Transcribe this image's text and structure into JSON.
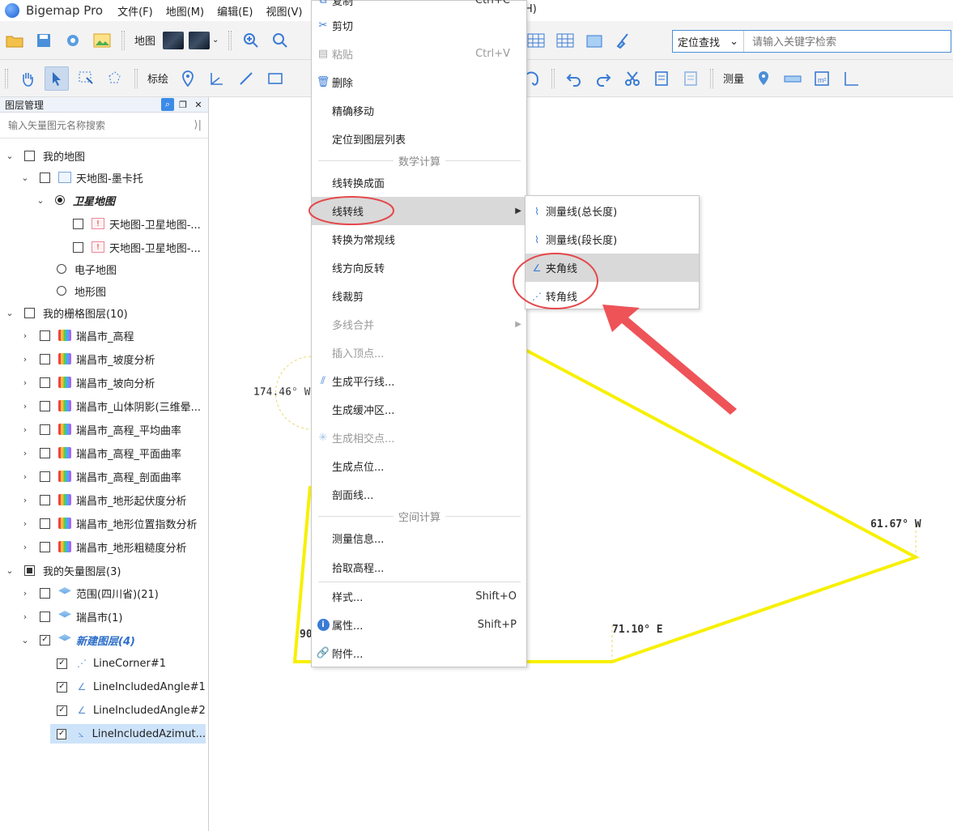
{
  "app": {
    "title": "Bigemap Pro",
    "menu_help_tail": "H)"
  },
  "menu": [
    "文件(F)",
    "地图(M)",
    "编辑(E)",
    "视图(V)"
  ],
  "toolbar1": {
    "map_label": "地图",
    "search_mode": "定位查找",
    "search_placeholder": "请输入关键字检索"
  },
  "toolbar2": {
    "mark_label": "标绘",
    "measure_label": "测量"
  },
  "layer_panel": {
    "title": "图层管理",
    "search_placeholder": "输入矢量图元名称搜索",
    "rows": [
      {
        "label": "我的地图"
      },
      {
        "label": "天地图-墨卡托"
      },
      {
        "label": "卫星地图"
      },
      {
        "label": "天地图-卫星地图-..."
      },
      {
        "label": "天地图-卫星地图-..."
      },
      {
        "label": "电子地图"
      },
      {
        "label": "地形图"
      },
      {
        "label": "我的栅格图层(10)"
      },
      {
        "label": "瑞昌市_高程"
      },
      {
        "label": "瑞昌市_坡度分析"
      },
      {
        "label": "瑞昌市_坡向分析"
      },
      {
        "label": "瑞昌市_山体阴影(三维晕..."
      },
      {
        "label": "瑞昌市_高程_平均曲率"
      },
      {
        "label": "瑞昌市_高程_平面曲率"
      },
      {
        "label": "瑞昌市_高程_剖面曲率"
      },
      {
        "label": "瑞昌市_地形起伏度分析"
      },
      {
        "label": "瑞昌市_地形位置指数分析"
      },
      {
        "label": "瑞昌市_地形粗糙度分析"
      },
      {
        "label": "我的矢量图层(3)"
      },
      {
        "label": "范围(四川省)(21)"
      },
      {
        "label": "瑞昌市(1)"
      },
      {
        "label": "新建图层(4)"
      },
      {
        "label": "LineCorner#1"
      },
      {
        "label": "LineIncludedAngle#1"
      },
      {
        "label": "LineIncludedAngle#2"
      },
      {
        "label": "LineIncludedAzimut..."
      }
    ]
  },
  "context_menu": {
    "items": [
      {
        "label": "复制",
        "shortcut": "Ctrl+C"
      },
      {
        "label": "剪切",
        "shortcut": ""
      },
      {
        "label": "粘贴",
        "shortcut": "Ctrl+V"
      },
      {
        "label": "删除",
        "shortcut": ""
      },
      {
        "label": "精确移动",
        "shortcut": ""
      },
      {
        "label": "定位到图层列表",
        "shortcut": ""
      },
      {
        "label": "数学计算"
      },
      {
        "label": "线转换成面",
        "shortcut": ""
      },
      {
        "label": "线转线",
        "shortcut": ""
      },
      {
        "label": "转换为常规线",
        "shortcut": ""
      },
      {
        "label": "线方向反转",
        "shortcut": ""
      },
      {
        "label": "线裁剪",
        "shortcut": ""
      },
      {
        "label": "多线合并",
        "shortcut": ""
      },
      {
        "label": "插入顶点...",
        "shortcut": ""
      },
      {
        "label": "生成平行线...",
        "shortcut": ""
      },
      {
        "label": "生成缓冲区...",
        "shortcut": ""
      },
      {
        "label": "生成相交点...",
        "shortcut": ""
      },
      {
        "label": "生成点位...",
        "shortcut": ""
      },
      {
        "label": "剖面线...",
        "shortcut": ""
      },
      {
        "label": "空间计算"
      },
      {
        "label": "测量信息...",
        "shortcut": ""
      },
      {
        "label": "拾取高程...",
        "shortcut": ""
      },
      {
        "label": "样式...",
        "shortcut": "Shift+O"
      },
      {
        "label": "属性...",
        "shortcut": "Shift+P"
      },
      {
        "label": "附件...",
        "shortcut": ""
      }
    ]
  },
  "submenu": {
    "items": [
      {
        "label": "测量线(总长度)"
      },
      {
        "label": "测量线(段长度)"
      },
      {
        "label": "夹角线"
      },
      {
        "label": "转角线"
      }
    ]
  },
  "map": {
    "annotations": [
      "174.46° W",
      "61.67° W",
      "71.10° E",
      "90"
    ],
    "line_color": "#f7f000",
    "highlight_color": "#e5474b"
  }
}
